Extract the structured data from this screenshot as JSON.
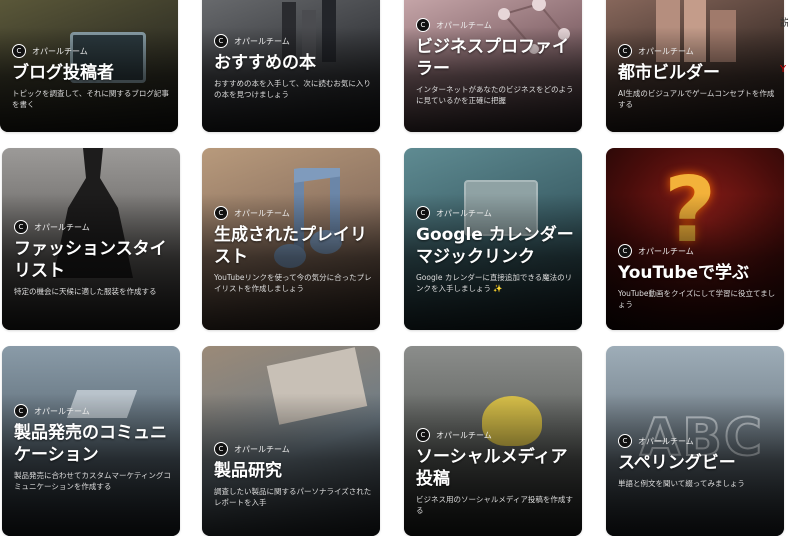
{
  "author_label": "オパールチーム",
  "cards": [
    {
      "title": "ブログ投稿者",
      "desc": "トピックを調査して、それに関するブログ記事を書く",
      "icon": "blog-icon"
    },
    {
      "title": "おすすめの本",
      "desc": "おすすめの本を入手して、次に読むお気に入りの本を見つけましょう",
      "icon": "books-icon"
    },
    {
      "title": "ビジネスプロファイラー",
      "desc": "インターネットがあなたのビジネスをどのように見ているかを正確に把握",
      "icon": "network-icon"
    },
    {
      "title": "都市ビルダー",
      "desc": "AI生成のビジュアルでゲームコンセプトを作成する",
      "icon": "city-icon"
    },
    {
      "title": "ファッションスタイリスト",
      "desc": "特定の機会に天候に適した服装を作成する",
      "icon": "dress-icon"
    },
    {
      "title": "生成されたプレイリスト",
      "desc": "YouTubeリンクを使って今の気分に合ったプレイリストを作成しましょう",
      "icon": "music-note-icon"
    },
    {
      "title": "Google カレンダー マジックリンク",
      "desc": "Google カレンダーに直接追加できる魔法のリンクを入手しましょう ✨",
      "icon": "calendar-icon"
    },
    {
      "title": "YouTubeで学ぶ",
      "desc": "YouTube動画をクイズにして学習に役立てましょう",
      "icon": "question-mark-icon"
    },
    {
      "title": "製品発売のコミュニケーション",
      "desc": "製品発売に合わせてカスタムマーケティングコミュニケーションを作成する",
      "icon": "product-icon"
    },
    {
      "title": "製品研究",
      "desc": "調査したい製品に関するパーソナライズされたレポートを入手",
      "icon": "research-icon"
    },
    {
      "title": "ソーシャルメディア投稿",
      "desc": "ビジネス用のソーシャルメディア投稿を作成する",
      "icon": "flower-icon"
    },
    {
      "title": "スペリングビー",
      "desc": "単語と例文を聞いて綴ってみましょう",
      "icon": "abc-icon"
    }
  ],
  "edge": {
    "c1": "説",
    "c2": "Y"
  }
}
